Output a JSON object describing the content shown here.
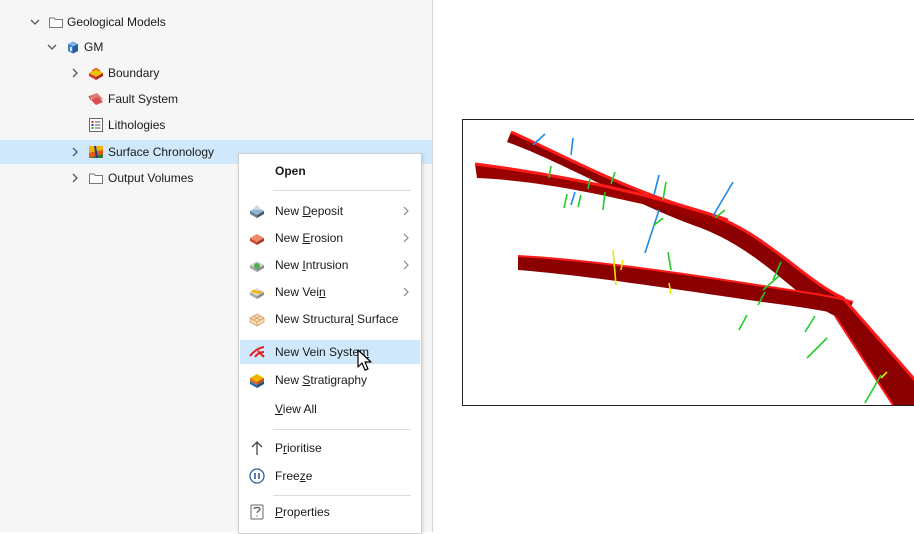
{
  "tree": {
    "items": [
      {
        "label": "Geological Models"
      },
      {
        "label": "GM"
      },
      {
        "label": "Boundary"
      },
      {
        "label": "Fault System"
      },
      {
        "label": "Lithologies"
      },
      {
        "label": "Surface Chronology"
      },
      {
        "label": "Output Volumes"
      }
    ],
    "selected_color": "#cfe8fb"
  },
  "context_menu": {
    "open": "Open",
    "new_deposit": {
      "pre": "New ",
      "u": "D",
      "post": "eposit"
    },
    "new_erosion": {
      "pre": "New ",
      "u": "E",
      "post": "rosion"
    },
    "new_intrusion": {
      "pre": "New ",
      "u": "I",
      "post": "ntrusion"
    },
    "new_vein": {
      "pre": "New Vei",
      "u": "n",
      "post": ""
    },
    "new_structural_surface": {
      "pre": "New Structura",
      "u": "l",
      "post": " Surface"
    },
    "new_vein_system": {
      "pre": "New Vein Syste",
      "u": "m",
      "post": ""
    },
    "new_stratigraphy": {
      "pre": "New ",
      "u": "S",
      "post": "tratigraphy"
    },
    "view_all": {
      "pre": "",
      "u": "V",
      "post": "iew All"
    },
    "prioritise": {
      "pre": "P",
      "u": "r",
      "post": "ioritise"
    },
    "freeze": {
      "pre": "Free",
      "u": "z",
      "post": "e"
    },
    "properties": {
      "pre": "",
      "u": "P",
      "post": "roperties"
    },
    "hover_color": "#cfe8fb"
  },
  "viewport": {
    "description_colors": {
      "vein": "#c00000",
      "disc_blue": "#1e88e5",
      "disc_green": "#22cc22",
      "disc_yellow": "#e8e800"
    }
  }
}
